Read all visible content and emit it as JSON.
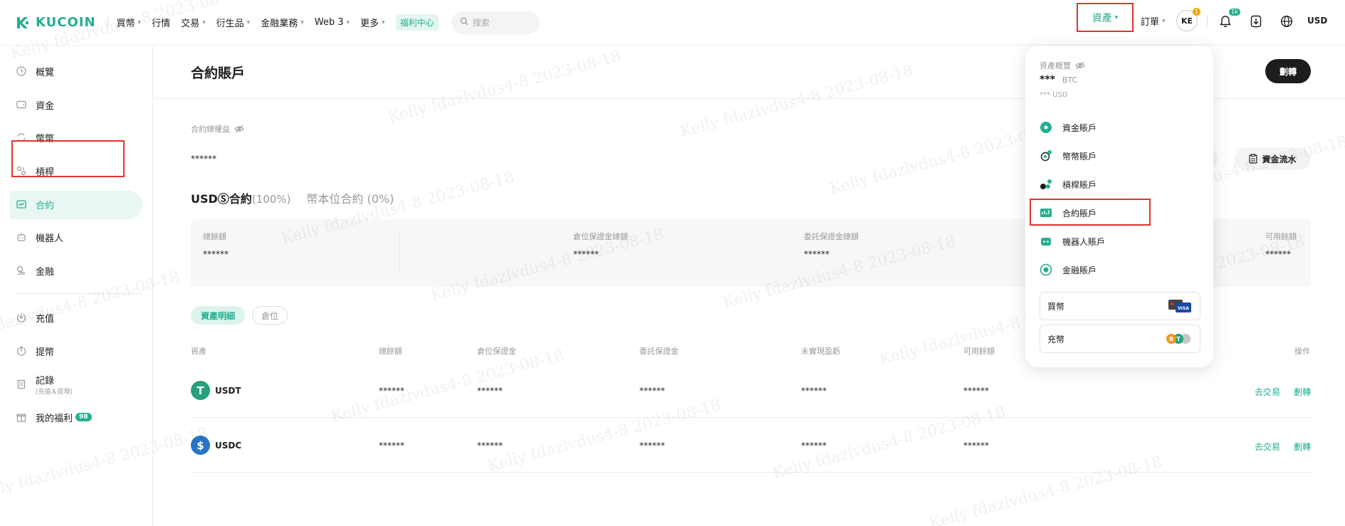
{
  "header": {
    "logo_text": "KUCOIN",
    "nav": [
      "買幣",
      "行情",
      "交易",
      "衍生品",
      "金融業務",
      "Web 3",
      "更多"
    ],
    "nav_has_chevron": [
      true,
      false,
      true,
      true,
      true,
      true,
      true
    ],
    "welfare": "福利中心",
    "search_placeholder": "搜索",
    "assets": "資產",
    "orders": "訂單",
    "avatar": "KE",
    "avatar_badge": "1",
    "bell_badge": "1k",
    "currency": "USD"
  },
  "sidebar": {
    "items": [
      "概覽",
      "資金",
      "幣幣",
      "槓桿",
      "合約",
      "機器人",
      "金融",
      "充值",
      "提幣",
      "記錄",
      "我的福利"
    ],
    "records_sub": "(充值＆提現)",
    "welfare_badge": "98"
  },
  "main": {
    "title": "合約賬戶",
    "transfer": "劃轉",
    "total_label": "合約總權益",
    "total_value": "******",
    "flow": "資金流水",
    "tab_a": "USDⓈ合約",
    "tab_a_pct": "(100%)",
    "tab_b": "幣本位合約 (0%)",
    "summary": [
      {
        "label": "總餘額",
        "value": "******"
      },
      {
        "label": "倉位保證金總額",
        "value": "******"
      },
      {
        "label": "委託保證金總額",
        "value": "******"
      },
      {
        "label": "可用餘額",
        "value": "******"
      }
    ],
    "pill_a": "資產明細",
    "pill_b": "倉位",
    "columns": [
      "資產",
      "總餘額",
      "倉位保證金",
      "委託保證金",
      "未實現盈虧",
      "可用餘額",
      "操作"
    ],
    "rows": [
      {
        "coin": "USDT",
        "cells": [
          "******",
          "******",
          "******",
          "******",
          "******"
        ],
        "trade": "去交易",
        "transfer": "劃轉",
        "color": "#26a17b"
      },
      {
        "coin": "USDC",
        "cells": [
          "******",
          "******",
          "******",
          "******",
          "******"
        ],
        "trade": "去交易",
        "transfer": "劃轉",
        "color": "#2775ca"
      }
    ]
  },
  "dropdown": {
    "overview": "資產概覽",
    "btc_value": "***",
    "btc_unit": "BTC",
    "usd_value": "*** USD",
    "items": [
      "資金賬戶",
      "幣幣賬戶",
      "槓桿賬戶",
      "合約賬戶",
      "機器人賬戶",
      "金融賬戶"
    ],
    "buy": "買幣",
    "deposit": "充幣"
  },
  "watermark": "Kelly fdazlvdus4-8 2023-08-18",
  "colors": {
    "accent": "#23af91",
    "highlight": "#e5312e",
    "dark": "#1d1d1d"
  }
}
